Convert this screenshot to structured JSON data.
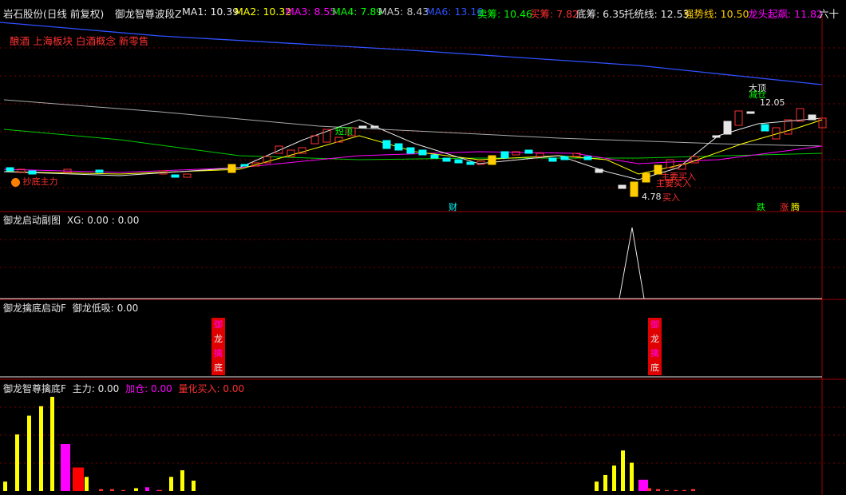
{
  "header": {
    "stock": "岩石股份(日线 前复权)",
    "indicator": "御龙智尊波段Z",
    "ma": [
      {
        "label": "MA1: 10.39",
        "color": "#e6e6e6"
      },
      {
        "label": "MA2: 10.32",
        "color": "#ffff00"
      },
      {
        "label": "MA3: 8.55",
        "color": "#ff00ff"
      },
      {
        "label": "MA4: 7.89",
        "color": "#00ff00"
      },
      {
        "label": "MA5: 8.43",
        "color": "#c8c8c8"
      },
      {
        "label": "MA6: 13.16",
        "color": "#3050ff"
      },
      {
        "label": "卖筹: 10.46",
        "color": "#00ff00"
      },
      {
        "label": "买筹: 7.82",
        "color": "#ff3030"
      },
      {
        "label": "底筹: 6.35",
        "color": "#e6e6e6"
      },
      {
        "label": "托统线: 12.53",
        "color": "#e6e6e6"
      },
      {
        "label": "强势线: 10.50",
        "color": "#ffcc00"
      },
      {
        "label": "龙头起飙: 11.82",
        "color": "#ff00ff"
      }
    ],
    "more": "六十"
  },
  "concepts": "酿酒 上海板块 白酒概念 新零售",
  "main_labels": {
    "top_label": "大顶",
    "top_label2": "减仓",
    "high_price": "12.05",
    "short_top": "短顶",
    "buy_point": "主要买入",
    "buy_point2": "主要买入",
    "low_price": "4.78",
    "buy": "买入",
    "bottom_left": "抄底",
    "bottom_left2": "主力",
    "cai": "财",
    "die": "跌",
    "zhang": "涨",
    "teng": "腾"
  },
  "panel2": {
    "title": "御龙启动副图",
    "xg": "XG: 0.00 : 0.00"
  },
  "panel3": {
    "title": "御龙擒底启动F",
    "dixi": "御龙低吸: 0.00",
    "chars": [
      "御",
      "龙",
      "擒",
      "底"
    ]
  },
  "panel4": {
    "title": "御龙智尊擒底F",
    "zhuli": {
      "text": "主力: 0.00",
      "color": "#e6e6e6"
    },
    "jiacang": {
      "text": "加仓: 0.00",
      "color": "#ff00ff"
    },
    "lianghua": {
      "text": "量化买入: 0.00",
      "color": "#ff3030"
    }
  },
  "chart_data": {
    "type": "bar",
    "volume_bars_left": [
      0.1,
      0.6,
      0.8,
      0.9,
      1.0,
      0.5,
      0.25,
      0.15,
      0.02,
      0.02,
      0.01,
      0.03,
      0.04,
      0.01,
      0.01,
      0.15,
      0.22,
      0.11
    ],
    "volume_bars_right": [
      0.1,
      0.17,
      0.27,
      0.43,
      0.3,
      0.12,
      0.03,
      0.02,
      0.01,
      0.01,
      0.01,
      0.02
    ]
  },
  "colors": {
    "up": "#ff3030",
    "down": "#00ffff",
    "divider": "#a00000"
  }
}
